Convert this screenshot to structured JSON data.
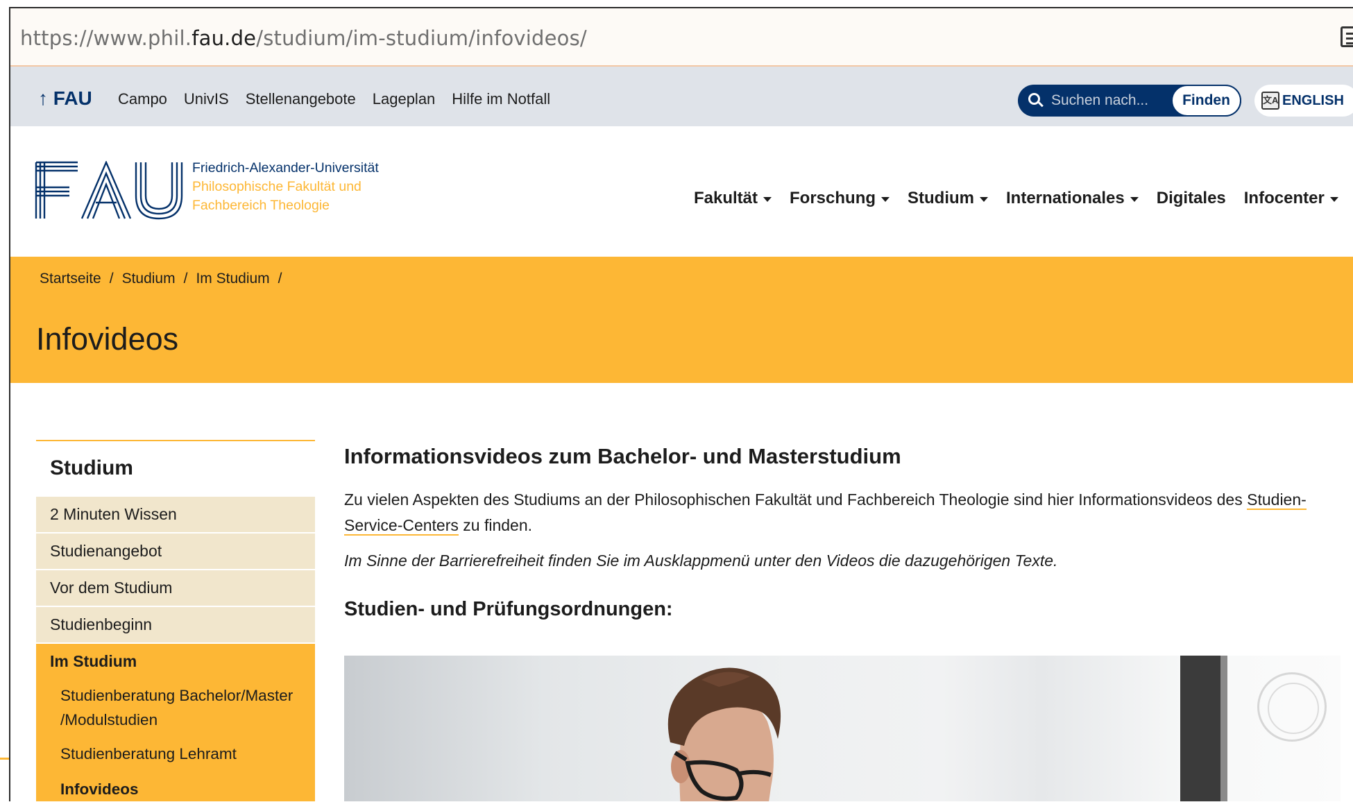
{
  "browser": {
    "url_prefix": "https://www.phil.",
    "url_domain": "fau.de",
    "url_path": "/studium/im-studium/infovideos/",
    "reader_icon": "reader-view-icon"
  },
  "servicebar": {
    "home_label": "↑ FAU",
    "links": [
      "Campo",
      "UnivIS",
      "Stellenangebote",
      "Lageplan",
      "Hilfe im Notfall"
    ],
    "search": {
      "placeholder": "Suchen nach...",
      "button": "Finden"
    },
    "language_button": "ENGLISH"
  },
  "header": {
    "logo_line1": "Friedrich-Alexander-Universität",
    "logo_line2": "Philosophische Fakultät und",
    "logo_line3": "Fachbereich Theologie",
    "nav": [
      {
        "label": "Fakultät",
        "has_caret": true
      },
      {
        "label": "Forschung",
        "has_caret": true
      },
      {
        "label": "Studium",
        "has_caret": true
      },
      {
        "label": "Internationales",
        "has_caret": true
      },
      {
        "label": "Digitales",
        "has_caret": false
      },
      {
        "label": "Infocenter",
        "has_caret": true
      }
    ]
  },
  "banner": {
    "breadcrumb": [
      "Startseite",
      "/",
      "Studium",
      "/",
      "Im Studium",
      "/"
    ],
    "title": "Infovideos"
  },
  "sidebar": {
    "title": "Studium",
    "items": [
      "2 Minuten Wissen",
      "Studienangebot",
      "Vor dem Studium",
      "Studienbeginn"
    ],
    "active": "Im Studium",
    "subitems": [
      "Studienberatung Bachelor/Master /Modulstudien",
      "Studienberatung Lehramt",
      "Infovideos"
    ]
  },
  "main": {
    "heading": "Informationsvideos zum Bachelor- und Masterstudium",
    "intro_before": "Zu vielen Aspekten des Studiums an der Philosophischen Fakultät und Fachbereich Theologie sind hier Informationsvideos des ",
    "intro_link": "Studien-Service-Centers",
    "intro_after": " zu finden.",
    "note": "Im Sinne der Barrierefreiheit finden Sie im Ausklappmenü unter den Videos die dazugehörigen Texte.",
    "subheading": "Studien- und Prüfungsordnungen:"
  },
  "colors": {
    "fau_blue": "#04316a",
    "accent_orange": "#fdb735",
    "sidebar_bg": "#f1e6cc",
    "servicebar_bg": "#dfe3e9"
  }
}
